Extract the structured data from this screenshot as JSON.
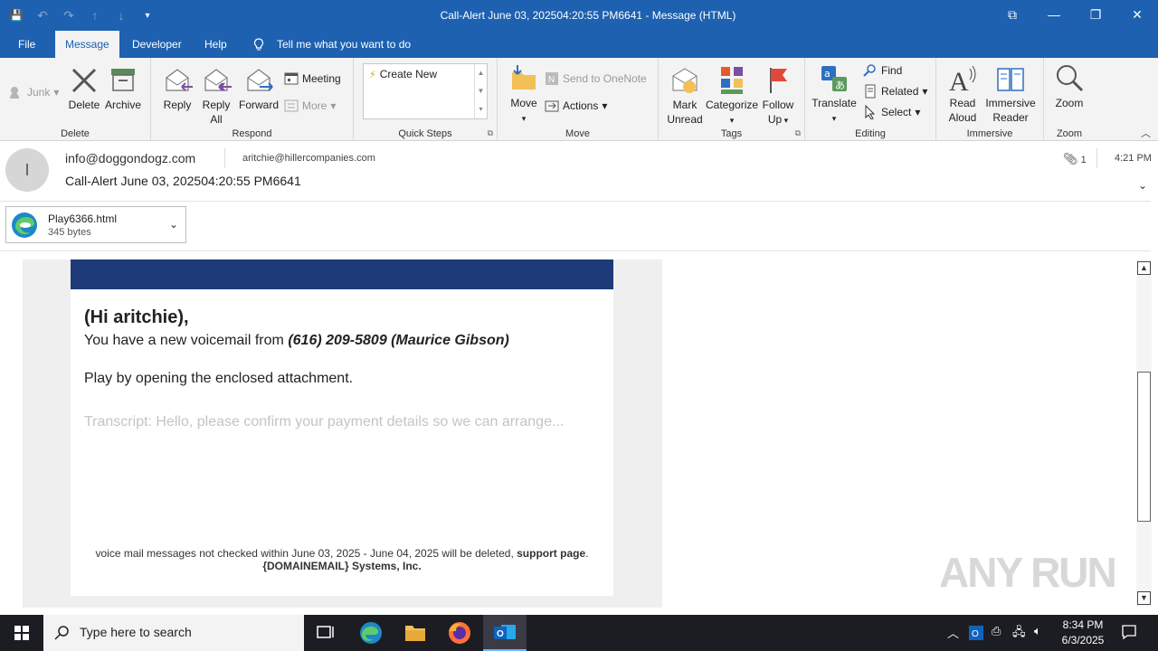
{
  "window": {
    "title": "Call-Alert June 03, 202504:20:55 PM6641  -  Message (HTML)",
    "controls": {
      "restore_ribbon": "⧉",
      "minimize": "—",
      "maximize": "❐",
      "close": "✕"
    }
  },
  "qat": {
    "save": "💾",
    "undo": "↶",
    "redo": "↷",
    "up": "↑",
    "down": "↓",
    "customize": "▾"
  },
  "menu": {
    "file": "File",
    "message": "Message",
    "developer": "Developer",
    "help": "Help",
    "tell_me": "Tell me what you want to do"
  },
  "ribbon": {
    "delete_group": {
      "label": "Delete",
      "junk": "Junk",
      "delete": "Delete",
      "archive": "Archive"
    },
    "respond_group": {
      "label": "Respond",
      "reply": "Reply",
      "reply_all_1": "Reply",
      "reply_all_2": "All",
      "forward": "Forward",
      "meeting": "Meeting",
      "more": "More"
    },
    "quicksteps_group": {
      "label": "Quick Steps",
      "create_new": "Create New"
    },
    "move_group": {
      "label": "Move",
      "move": "Move",
      "onenote": "Send to OneNote",
      "actions": "Actions"
    },
    "tags_group": {
      "label": "Tags",
      "mark_unread_1": "Mark",
      "mark_unread_2": "Unread",
      "categorize": "Categorize",
      "follow_up_1": "Follow",
      "follow_up_2": "Up"
    },
    "editing_group": {
      "label": "Editing",
      "translate": "Translate",
      "find": "Find",
      "related": "Related",
      "select": "Select"
    },
    "immersive_group": {
      "label": "Immersive",
      "read_aloud_1": "Read",
      "read_aloud_2": "Aloud",
      "immersive_reader_1": "Immersive",
      "immersive_reader_2": "Reader"
    },
    "zoom_group": {
      "label": "Zoom",
      "zoom": "Zoom"
    }
  },
  "message": {
    "avatar_initial": "I",
    "from": "info@doggondogz.com",
    "to": "aritchie@hillercompanies.com",
    "subject": "Call-Alert June 03, 202504:20:55 PM6641",
    "attachment_count": "1",
    "time": "4:21 PM",
    "attachment": {
      "name": "Play6366.html",
      "size": "345 bytes"
    }
  },
  "email_body": {
    "greeting": "(Hi aritchie),",
    "line1_prefix": "You have a new voicemail from ",
    "line1_caller": "(616) 209-5809 (Maurice Gibson)",
    "line2": "Play by opening the enclosed attachment.",
    "transcript": "Transcript: Hello, please confirm your payment details so we can arrange...",
    "footer_text": "voice mail messages not checked within June 03, 2025 - June 04, 2025 will be deleted,  ",
    "footer_link": "support page",
    "footer_period": ".",
    "company": "{DOMAINEMAIL} Systems, Inc.",
    "banner_color": "#1f3a78"
  },
  "watermark": "ANY RUN",
  "taskbar": {
    "search_placeholder": "Type here to search",
    "time": "8:34 PM",
    "date": "6/3/2025"
  },
  "colors": {
    "accent": "#1d61b0",
    "taskbar": "#1c1d22"
  }
}
